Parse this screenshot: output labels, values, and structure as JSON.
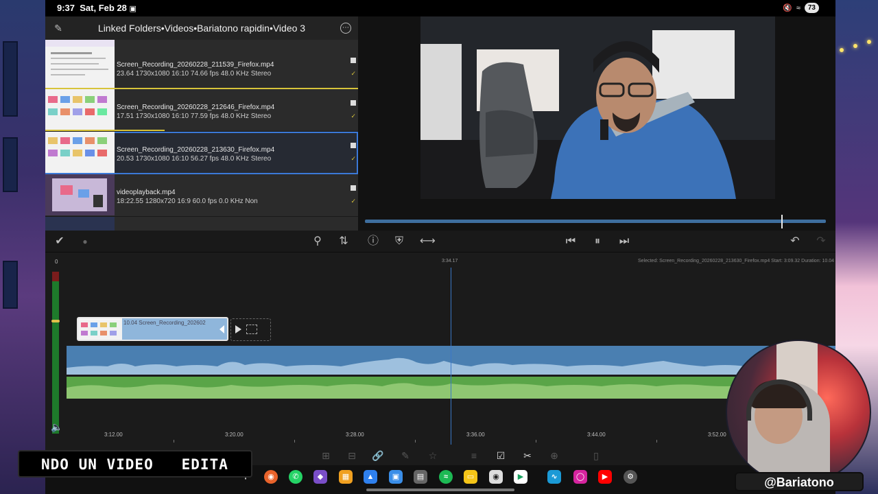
{
  "status_bar": {
    "time": "9:37",
    "date": "Sat, Feb 28",
    "battery": "73"
  },
  "browser": {
    "breadcrumb": "Linked Folders•Videos•Bariatono rapidin•Video 3",
    "items": [
      {
        "name": "Screen_Recording_20260228_211539_Firefox.mp4",
        "meta": "23.64 1730x1080 16:10 74.66 fps 48.0 KHz Stereo"
      },
      {
        "name": "Screen_Recording_20260228_212646_Firefox.mp4",
        "meta": "17.51 1730x1080 16:10 77.59 fps 48.0 KHz Stereo"
      },
      {
        "name": "Screen_Recording_20260228_213630_Firefox.mp4",
        "meta": "20.53 1730x1080 16:10 56.27 fps 48.0 KHz Stereo"
      },
      {
        "name": "videoplayback.mp4",
        "meta": "18:22.55 1280x720 16:9 60.0 fps 0.0 KHz Non"
      }
    ]
  },
  "timeline": {
    "current_time": "3:34.17",
    "selected_info": "Selected: Screen_Recording_20260228_213630_Firefox.mp4 Start: 3:09.32 Duration: 10.04",
    "meter_zero": "0",
    "clip_label": "10.04 Screen_Recording_202602",
    "ruler": [
      "3:12.00",
      "3:20.00",
      "3:28.00",
      "3:36.00",
      "3:44.00",
      "3:52.00"
    ]
  },
  "overlay": {
    "ticker": "NDO UN VIDEO   EDITA",
    "handle": "@Bariatono"
  },
  "colors": {
    "accent_blue": "#3b79d8",
    "track_blue": "#4a7fb1",
    "track_green": "#5aa548",
    "progress_yellow": "#d8c43a"
  }
}
